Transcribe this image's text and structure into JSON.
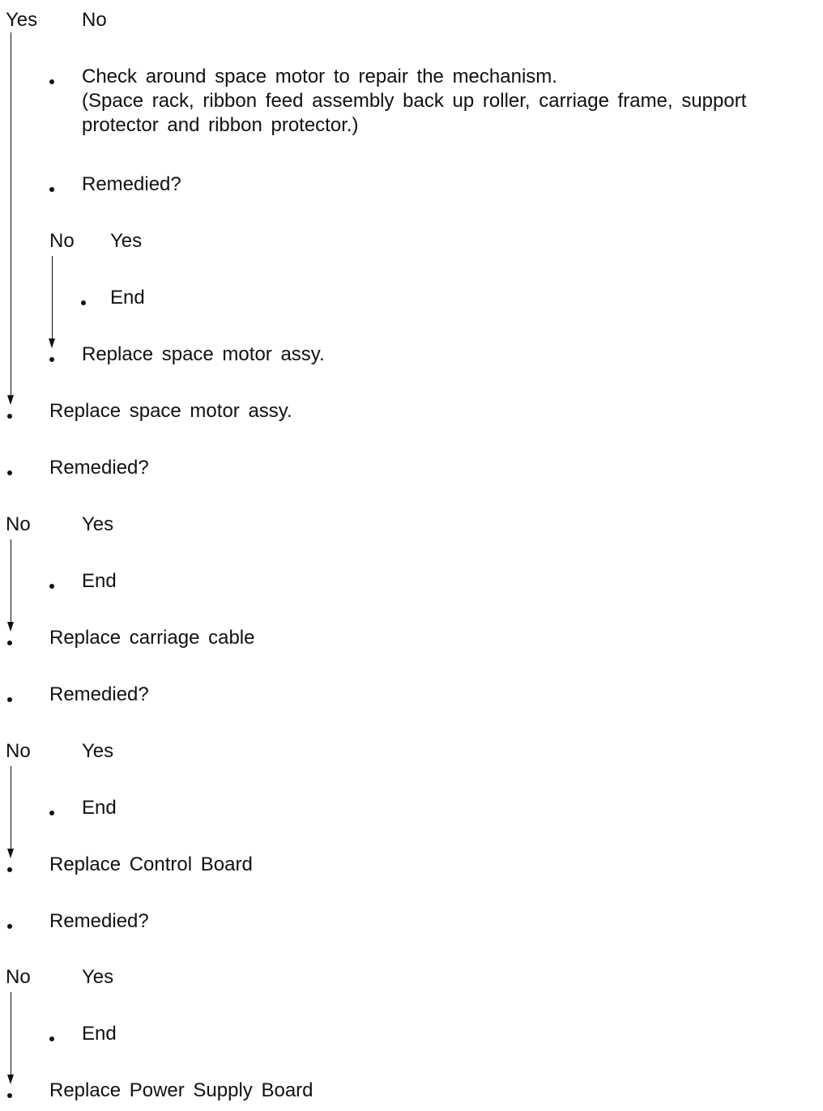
{
  "flow": {
    "top": {
      "yes": "Yes",
      "no": "No"
    },
    "check": {
      "line1": "Check around space motor to repair the mechanism.",
      "line2": "(Space rack, ribbon feed assembly back up roller, carriage frame, support",
      "line3": "protector and ribbon protector.)"
    },
    "remedied_1": "Remedied?",
    "branch_1": {
      "no": "No",
      "yes": "Yes",
      "end": "End"
    },
    "inner_replace": "Replace space motor assy.",
    "outer_replace": "Replace space motor assy.",
    "remedied_2": "Remedied?",
    "branch_2": {
      "no": "No",
      "yes": "Yes",
      "end": "End"
    },
    "replace_cable": "Replace carriage cable",
    "remedied_3": "Remedied?",
    "branch_3": {
      "no": "No",
      "yes": "Yes",
      "end": "End"
    },
    "replace_control": "Replace Control Board",
    "remedied_4": "Remedied?",
    "branch_4": {
      "no": "No",
      "yes": "Yes",
      "end": "End"
    },
    "replace_power": "Replace Power Supply Board"
  }
}
